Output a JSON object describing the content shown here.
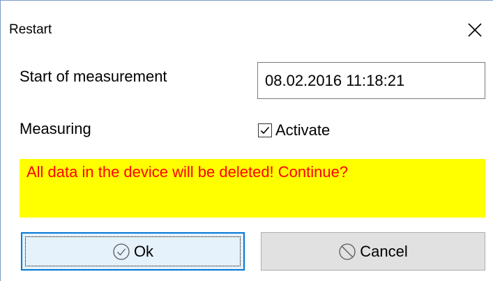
{
  "window": {
    "title": "Restart",
    "close_icon": "close-icon"
  },
  "form": {
    "start_label": "Start of measurement",
    "start_value": "08.02.2016 11:18:21",
    "measuring_label": "Measuring",
    "activate_label": "Activate",
    "activate_checked": true
  },
  "warning": {
    "text": "All data in the device will be deleted! Continue?",
    "background": "#ffff00",
    "color": "#ff0000"
  },
  "buttons": {
    "ok_label": "Ok",
    "ok_icon": "check-circle-icon",
    "cancel_label": "Cancel",
    "cancel_icon": "no-entry-icon"
  },
  "colors": {
    "focus_border": "#0078d7",
    "button_face": "#e1e1e1"
  }
}
